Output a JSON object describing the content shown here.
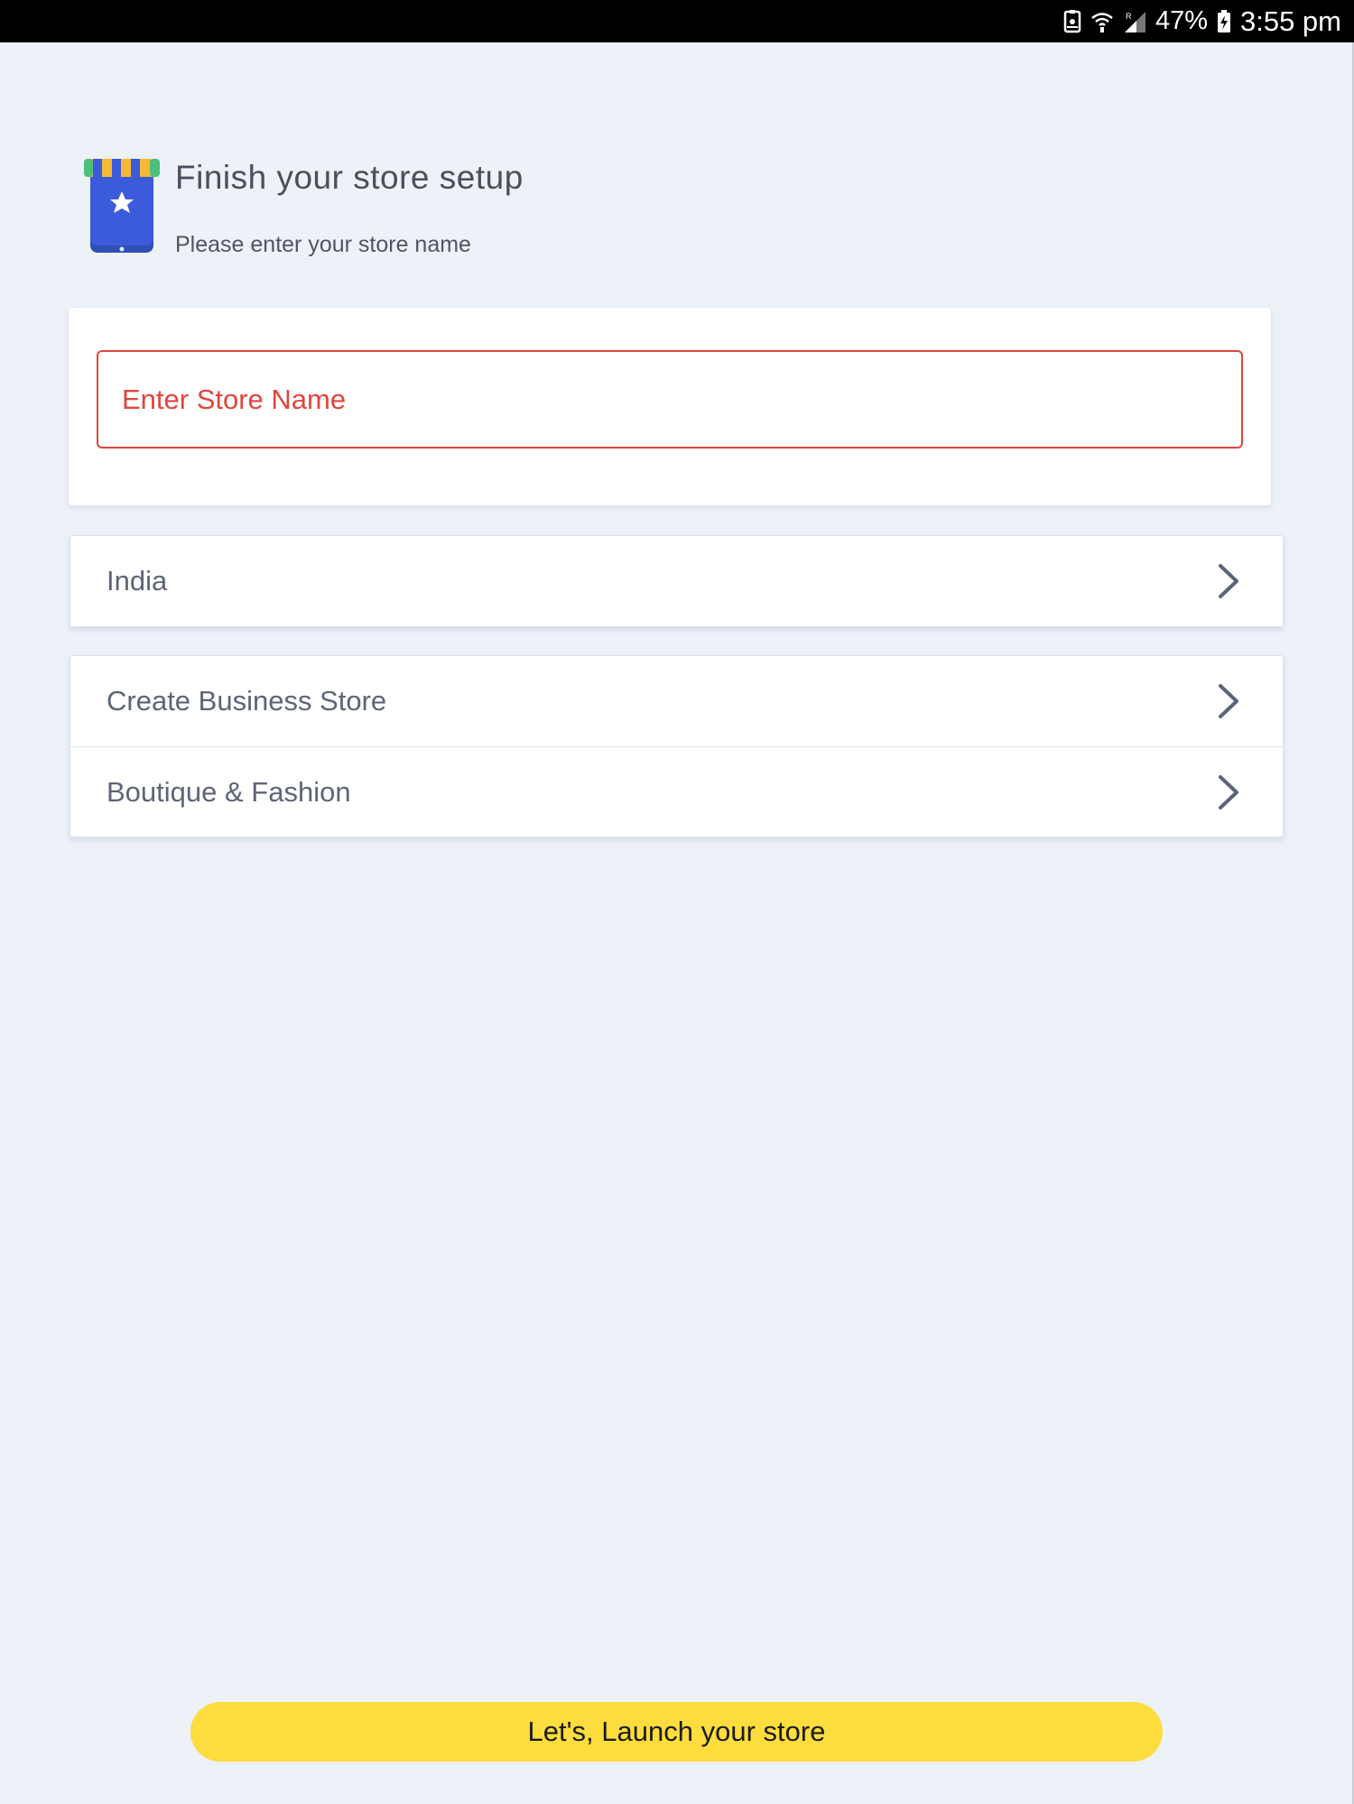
{
  "status_bar": {
    "battery_percent": "47%",
    "time": "3:55 pm",
    "icons": [
      "screenshot-icon",
      "wifi-icon",
      "signal-icon",
      "battery-icon"
    ]
  },
  "header": {
    "icon": "store-icon",
    "title": "Finish your store setup",
    "subtitle": "Please enter your store name"
  },
  "store_name": {
    "value": "",
    "placeholder": "Enter Store Name"
  },
  "country": {
    "label": "India",
    "icon": "chevron-right-icon"
  },
  "store_options": [
    {
      "label": "Create Business Store",
      "icon": "chevron-right-icon"
    },
    {
      "label": "Boutique & Fashion",
      "icon": "chevron-right-icon"
    }
  ],
  "launch_button": {
    "label": "Let's, Launch your store"
  },
  "colors": {
    "background": "#edf1f8",
    "error": "#e0463d",
    "button": "#fddc3d",
    "icon_blue": "#3b5bdb"
  }
}
